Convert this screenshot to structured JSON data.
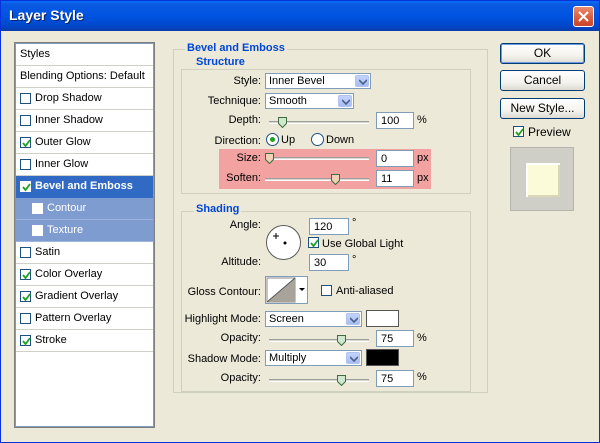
{
  "window": {
    "title": "Layer Style"
  },
  "left_panel": {
    "items": [
      {
        "label": "Styles",
        "checkbox": false,
        "checked": false,
        "state": "header"
      },
      {
        "label": "Blending Options: Default",
        "checkbox": false,
        "checked": false,
        "state": "header"
      },
      {
        "label": "Drop Shadow",
        "checkbox": true,
        "checked": false,
        "state": "normal"
      },
      {
        "label": "Inner Shadow",
        "checkbox": true,
        "checked": false,
        "state": "normal"
      },
      {
        "label": "Outer Glow",
        "checkbox": true,
        "checked": true,
        "state": "normal"
      },
      {
        "label": "Inner Glow",
        "checkbox": true,
        "checked": false,
        "state": "normal"
      },
      {
        "label": "Bevel and Emboss",
        "checkbox": true,
        "checked": true,
        "state": "selected"
      },
      {
        "label": "Contour",
        "checkbox": true,
        "checked": false,
        "state": "sub"
      },
      {
        "label": "Texture",
        "checkbox": true,
        "checked": false,
        "state": "sub"
      },
      {
        "label": "Satin",
        "checkbox": true,
        "checked": false,
        "state": "normal"
      },
      {
        "label": "Color Overlay",
        "checkbox": true,
        "checked": true,
        "state": "normal"
      },
      {
        "label": "Gradient Overlay",
        "checkbox": true,
        "checked": true,
        "state": "normal"
      },
      {
        "label": "Pattern Overlay",
        "checkbox": true,
        "checked": false,
        "state": "normal"
      },
      {
        "label": "Stroke",
        "checkbox": true,
        "checked": true,
        "state": "normal"
      }
    ]
  },
  "bevel": {
    "section_title": "Bevel and Emboss",
    "structure": {
      "title": "Structure",
      "style_label": "Style:",
      "style_value": "Inner Bevel",
      "technique_label": "Technique:",
      "technique_value": "Smooth",
      "depth_label": "Depth:",
      "depth_value": "100",
      "depth_unit": "%",
      "depth_slider_fraction": 0.1,
      "direction_label": "Direction:",
      "direction_up": "Up",
      "direction_down": "Down",
      "direction_selected": "Up",
      "size_label": "Size:",
      "size_value": "0",
      "size_unit": "px",
      "size_slider_fraction": 0.0,
      "soften_label": "Soften:",
      "soften_value": "11",
      "soften_unit": "px",
      "soften_slider_fraction": 0.69
    },
    "shading": {
      "title": "Shading",
      "angle_label": "Angle:",
      "angle_value": "120",
      "angle_unit": "°",
      "use_global_light_label": "Use Global Light",
      "use_global_light": true,
      "altitude_label": "Altitude:",
      "altitude_value": "30",
      "altitude_unit": "°",
      "gloss_contour_label": "Gloss Contour:",
      "anti_aliased_label": "Anti-aliased",
      "anti_aliased": false,
      "highlight_mode_label": "Highlight Mode:",
      "highlight_mode_value": "Screen",
      "highlight_color": "#ffffff",
      "highlight_opacity_label": "Opacity:",
      "highlight_opacity_value": "75",
      "highlight_opacity_unit": "%",
      "highlight_opacity_fraction": 0.75,
      "shadow_mode_label": "Shadow Mode:",
      "shadow_mode_value": "Multiply",
      "shadow_color": "#000000",
      "shadow_opacity_label": "Opacity:",
      "shadow_opacity_value": "75",
      "shadow_opacity_unit": "%",
      "shadow_opacity_fraction": 0.75
    }
  },
  "buttons": {
    "ok": "OK",
    "cancel": "Cancel",
    "new_style": "New Style...",
    "preview_label": "Preview",
    "preview_checked": true
  },
  "colors": {
    "title_bar": "#0053e1",
    "selected_row": "#316ac5",
    "sub_row": "#7f9cd1",
    "section_title": "#0046d5",
    "highlight_band": "#f3a2a2"
  }
}
